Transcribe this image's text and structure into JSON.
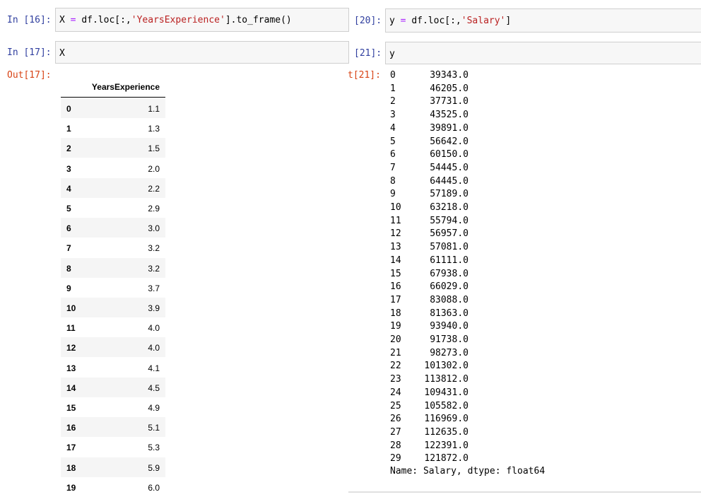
{
  "left_cells": {
    "in16": {
      "prompt": "In [16]:",
      "code": {
        "var": "X",
        "op": " = ",
        "pre": "df.loc[:,",
        "str": "'YearsExperience'",
        "post": "].to_frame()"
      }
    },
    "in17": {
      "prompt": "In [17]:",
      "code": "X"
    },
    "out17": {
      "prompt": "Out[17]:",
      "column_header": "YearsExperience",
      "rows": [
        {
          "index": "0",
          "value": "1.1"
        },
        {
          "index": "1",
          "value": "1.3"
        },
        {
          "index": "2",
          "value": "1.5"
        },
        {
          "index": "3",
          "value": "2.0"
        },
        {
          "index": "4",
          "value": "2.2"
        },
        {
          "index": "5",
          "value": "2.9"
        },
        {
          "index": "6",
          "value": "3.0"
        },
        {
          "index": "7",
          "value": "3.2"
        },
        {
          "index": "8",
          "value": "3.2"
        },
        {
          "index": "9",
          "value": "3.7"
        },
        {
          "index": "10",
          "value": "3.9"
        },
        {
          "index": "11",
          "value": "4.0"
        },
        {
          "index": "12",
          "value": "4.0"
        },
        {
          "index": "13",
          "value": "4.1"
        },
        {
          "index": "14",
          "value": "4.5"
        },
        {
          "index": "15",
          "value": "4.9"
        },
        {
          "index": "16",
          "value": "5.1"
        },
        {
          "index": "17",
          "value": "5.3"
        },
        {
          "index": "18",
          "value": "5.9"
        },
        {
          "index": "19",
          "value": "6.0"
        }
      ]
    }
  },
  "right_cells": {
    "in20": {
      "prompt": "[20]:",
      "code": {
        "var": "y",
        "op": " = ",
        "pre": "df.loc[:,",
        "str": "'Salary'",
        "post": "]"
      }
    },
    "in21": {
      "prompt": "[21]:",
      "code": "y"
    },
    "out21": {
      "prompt": "t[21]:",
      "rows": [
        {
          "index": "0",
          "value": "39343.0"
        },
        {
          "index": "1",
          "value": "46205.0"
        },
        {
          "index": "2",
          "value": "37731.0"
        },
        {
          "index": "3",
          "value": "43525.0"
        },
        {
          "index": "4",
          "value": "39891.0"
        },
        {
          "index": "5",
          "value": "56642.0"
        },
        {
          "index": "6",
          "value": "60150.0"
        },
        {
          "index": "7",
          "value": "54445.0"
        },
        {
          "index": "8",
          "value": "64445.0"
        },
        {
          "index": "9",
          "value": "57189.0"
        },
        {
          "index": "10",
          "value": "63218.0"
        },
        {
          "index": "11",
          "value": "55794.0"
        },
        {
          "index": "12",
          "value": "56957.0"
        },
        {
          "index": "13",
          "value": "57081.0"
        },
        {
          "index": "14",
          "value": "61111.0"
        },
        {
          "index": "15",
          "value": "67938.0"
        },
        {
          "index": "16",
          "value": "66029.0"
        },
        {
          "index": "17",
          "value": "83088.0"
        },
        {
          "index": "18",
          "value": "81363.0"
        },
        {
          "index": "19",
          "value": "93940.0"
        },
        {
          "index": "20",
          "value": "91738.0"
        },
        {
          "index": "21",
          "value": "98273.0"
        },
        {
          "index": "22",
          "value": "101302.0"
        },
        {
          "index": "23",
          "value": "113812.0"
        },
        {
          "index": "24",
          "value": "109431.0"
        },
        {
          "index": "25",
          "value": "105582.0"
        },
        {
          "index": "26",
          "value": "116969.0"
        },
        {
          "index": "27",
          "value": "112635.0"
        },
        {
          "index": "28",
          "value": "122391.0"
        },
        {
          "index": "29",
          "value": "121872.0"
        }
      ],
      "footer": "Name: Salary, dtype: float64"
    }
  },
  "colors": {
    "in_prompt": "#303f9f",
    "out_prompt": "#d84315",
    "string": "#ba2121",
    "operator": "#aa22ff",
    "cell_bg": "#f7f7f7",
    "row_stripe": "#f5f5f5"
  }
}
